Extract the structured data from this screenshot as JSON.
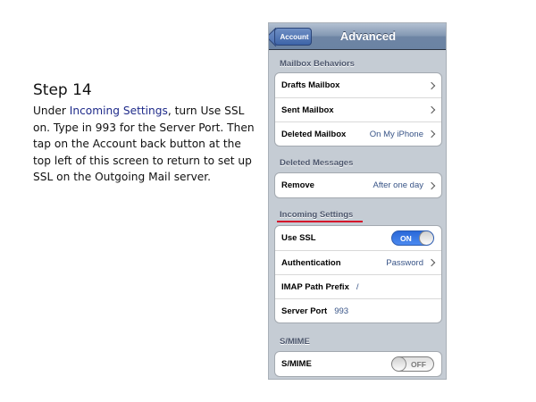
{
  "slide": {
    "step_title": "Step 14",
    "instruction": {
      "part1": "Under ",
      "highlight": "Incoming Settings",
      "part2": ", turn Use SSL on. Type in 993 for the Server Port. Then tap on the Account back button at the top left of this screen to return to set up SSL on the Outgoing Mail server."
    }
  },
  "navbar": {
    "back_label": "Account",
    "title": "Advanced"
  },
  "sections": {
    "mailbox_behaviors": {
      "header": "Mailbox Behaviors",
      "rows": [
        {
          "label": "Drafts Mailbox",
          "value": ""
        },
        {
          "label": "Sent Mailbox",
          "value": ""
        },
        {
          "label": "Deleted Mailbox",
          "value": "On My iPhone"
        }
      ]
    },
    "deleted_messages": {
      "header": "Deleted Messages",
      "rows": [
        {
          "label": "Remove",
          "value": "After one day"
        }
      ]
    },
    "incoming_settings": {
      "header": "Incoming Settings",
      "use_ssl": {
        "label": "Use SSL",
        "toggle": "ON"
      },
      "authentication": {
        "label": "Authentication",
        "value": "Password"
      },
      "imap_path_prefix": {
        "label": "IMAP Path Prefix",
        "value": "/"
      },
      "server_port": {
        "label": "Server Port",
        "value": "993"
      }
    },
    "smime": {
      "header": "S/MIME",
      "row": {
        "label": "S/MIME",
        "toggle": "OFF"
      }
    }
  },
  "colors": {
    "highlight_text": "#1f2b8a",
    "underline": "#d4112b",
    "toggle_on": "#2a68d8"
  }
}
